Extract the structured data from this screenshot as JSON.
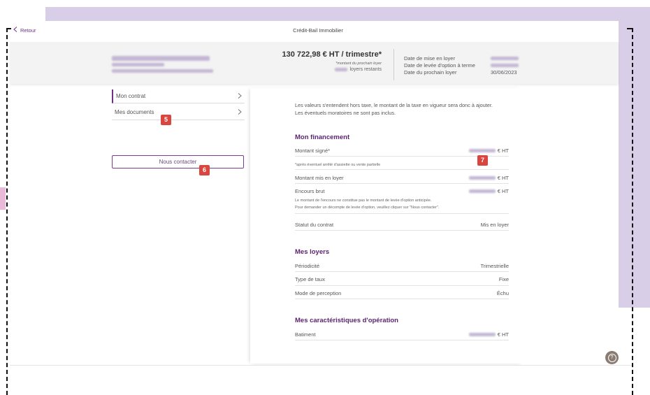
{
  "colors": {
    "accent": "#6e2f84",
    "heading": "#5c2370",
    "lavender": "#d8cee8",
    "marker_badge": "#d9453f",
    "highlight_pink": "#e8bad7",
    "help_button": "#8a7b73"
  },
  "header": {
    "back_icon": "chevron-left-icon",
    "back_label": "Retour",
    "title": "Crédit-Bail Immobilier"
  },
  "summary": {
    "amount": "130 722,98 € HT / trimestre*",
    "amount_note": "*montant du prochain loyer",
    "remaining_suffix": "loyers restants",
    "dates": [
      {
        "label": "Date de mise en loyer"
      },
      {
        "label": "Date de levée d'option à terme"
      },
      {
        "label": "Date du prochain loyer",
        "value": "30/06/2023"
      }
    ]
  },
  "menu": {
    "items": [
      {
        "label": "Mon contrat",
        "active": true,
        "icon": "chevron-right-icon"
      },
      {
        "label": "Mes documents",
        "active": false,
        "icon": "chevron-right-icon"
      }
    ],
    "contact_button": "Nous contacter"
  },
  "markers": [
    "5",
    "6",
    "7"
  ],
  "main": {
    "intro": [
      "Les valeurs s'entendent hors taxe, le montant de la taxe en vigueur sera donc à ajouter.",
      "Les éventuels moratoires ne sont pas inclus."
    ],
    "financement": {
      "title": "Mon financement",
      "rows": [
        {
          "label": "Montant signé*",
          "unit": "€ HT"
        },
        {
          "label": "Montant mis en loyer",
          "unit": "€ HT"
        },
        {
          "label": "Encours brut",
          "unit": "€ HT"
        },
        {
          "label": "Statut du contrat",
          "value": "Mis en loyer"
        }
      ],
      "signed_note": "*après éventuel arrêté d'assiette ou vente partielle",
      "outstanding_note": [
        "Le montant de l'encours ne constitue pas le montant de levée d'option anticipée.",
        "Pour demander un décompte de levée d'option, veuillez cliquer sur \"Nous contacter\"."
      ]
    },
    "loyers": {
      "title": "Mes loyers",
      "rows": [
        {
          "label": "Périodicité",
          "value": "Trimestrielle"
        },
        {
          "label": "Type de taux",
          "value": "Fixe"
        },
        {
          "label": "Mode de perception",
          "value": "Échu"
        }
      ]
    },
    "operation": {
      "title": "Mes caractéristiques d'opération",
      "rows": [
        {
          "label": "Batiment",
          "unit": "€ HT"
        }
      ]
    }
  },
  "help_button": {
    "icon": "question-circle-icon",
    "label": "?"
  }
}
